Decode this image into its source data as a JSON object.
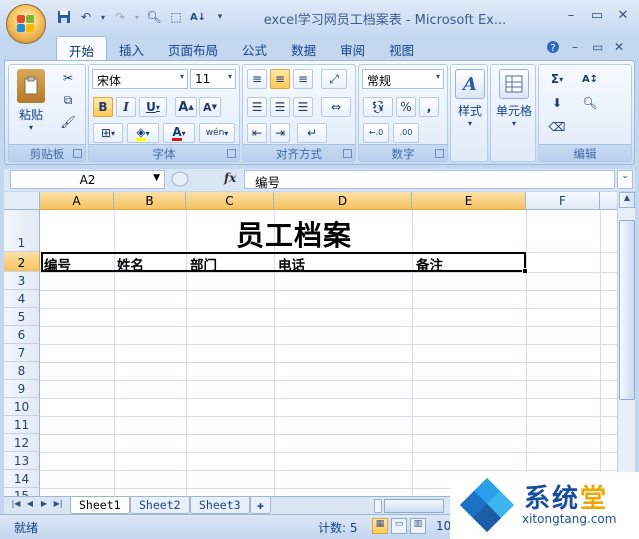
{
  "window": {
    "title": "excel学习网员工档案表 - Microsoft Ex...",
    "controls": {
      "minimize": "–",
      "restore": "▭",
      "close": "✕"
    }
  },
  "ribbon_tabs": [
    "开始",
    "插入",
    "页面布局",
    "公式",
    "数据",
    "审阅",
    "视图"
  ],
  "ribbon": {
    "clipboard": {
      "paste_label": "粘贴",
      "group_label": "剪贴板"
    },
    "font": {
      "font_name": "宋体",
      "font_size": "11",
      "bold": "B",
      "italic": "I",
      "underline": "U",
      "grow": "A",
      "shrink": "A",
      "color_letter": "A",
      "phonetic": "wén",
      "group_label": "字体"
    },
    "alignment": {
      "group_label": "对齐方式"
    },
    "number": {
      "format": "常规",
      "percent": "%",
      "comma": ",",
      "inc_decimal": "←.0\n.00",
      "dec_decimal": ".00\n→.0",
      "group_label": "数字"
    },
    "styles": {
      "label": "样式"
    },
    "cells": {
      "label": "单元格"
    },
    "editing": {
      "sum": "Σ",
      "group_label": "编辑"
    }
  },
  "formula_bar": {
    "name_box": "A2",
    "fx": "fx",
    "content": "编号"
  },
  "grid": {
    "columns": [
      "A",
      "B",
      "C",
      "D",
      "E",
      "F"
    ],
    "rows": [
      "1",
      "2",
      "3",
      "4",
      "5",
      "6",
      "7",
      "8",
      "9",
      "10",
      "11",
      "12",
      "13",
      "14",
      "15"
    ],
    "title": "员工档案",
    "headers": [
      "编号",
      "姓名",
      "部门",
      "电话",
      "备注"
    ]
  },
  "sheets": [
    "Sheet1",
    "Sheet2",
    "Sheet3"
  ],
  "status": {
    "ready": "就绪",
    "count": "计数: 5",
    "zoom": "10"
  },
  "watermark": {
    "name_part1": "系统",
    "name_part2": "堂",
    "url": "xitongtang.com"
  },
  "colors": {
    "accent": "#15428b",
    "selection_header": "#f6c460",
    "ribbon_bg": "#dce8f7"
  }
}
